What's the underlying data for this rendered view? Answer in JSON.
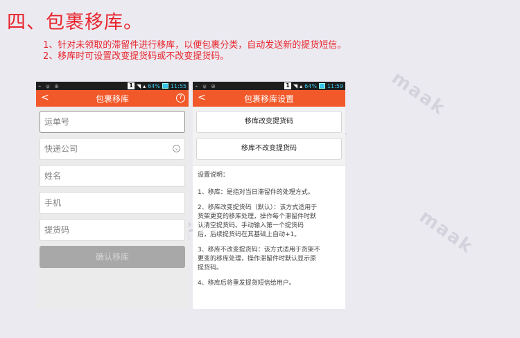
{
  "header": {
    "title": "四、包裹移库。",
    "desc1": "1、针对未领取的滞留件进行移库，以便包裹分类，自动发送新的提货短信。",
    "desc2": "2、移库时可设置改变提货码或不改变提货码。"
  },
  "watermark": "maak",
  "status_left": {
    "sim": "1",
    "battery": "64%",
    "time": "11:55"
  },
  "status_right": {
    "sim": "1",
    "battery": "64%",
    "time": "11:59"
  },
  "screen1": {
    "back": "<",
    "title": "包裹移库",
    "help": "?",
    "waybill_placeholder": "运单号",
    "courier_placeholder": "快递公司",
    "name_placeholder": "姓名",
    "phone_placeholder": "手机",
    "pickup_code_placeholder": "提货码",
    "confirm_label": "确认移库"
  },
  "screen2": {
    "back": "<",
    "title": "包裹移库设置",
    "option1": "移库改变提货码",
    "option2": "移库不改变提货码",
    "info_title": "设置说明：",
    "info1": "1、移库：是指对当日滞留件的处理方式。",
    "info2": "2、移库改变提货码（默认）：该方式适用于\n货架更变的移库处理，操作每个滞留件时默\n认清空提货码。手动输入第一个提货码\n后，后续提货码在其基础上自动+1。",
    "info3": "3、移库不改变提货码：该方式适用于货架不\n更变的移库处理，操作滞留件时默认显示原\n提货码。",
    "info4": "4、移库后将重发提货短信给用户。"
  },
  "colors": {
    "accent": "#f1592a",
    "title_red": "#e8242c",
    "background": "#eceaf1"
  }
}
